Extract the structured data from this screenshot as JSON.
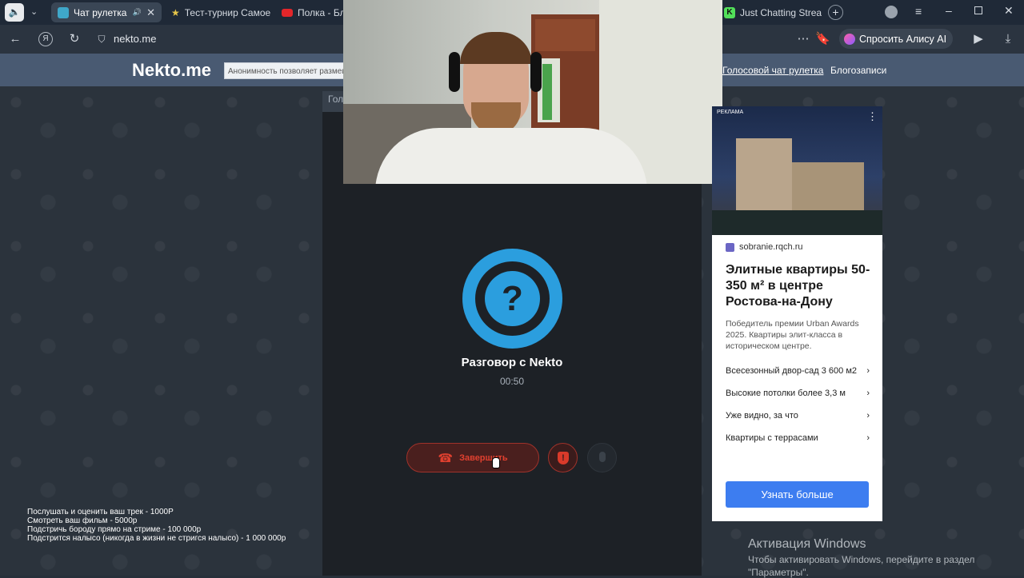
{
  "tabs": [
    {
      "title": "Чат рулетка го"
    },
    {
      "title": "Тест-турнир Самое"
    },
    {
      "title": "Полка - Бли"
    },
    {
      "title": "Just Chatting Strea"
    }
  ],
  "address": {
    "url": "nekto.me",
    "alice_button": "Спросить Алису AI"
  },
  "site": {
    "logo": "Nekto.me",
    "search_text": "Анонимность позволяет размеща",
    "nav": [
      "Голосовой чат рулетка",
      "Блогозаписи"
    ],
    "side_tab_partial": "Гол"
  },
  "call": {
    "title": "Разговор с Nekto",
    "timer": "00:50",
    "end_button": "Завершить"
  },
  "ad": {
    "label": "РЕКЛАМА",
    "domain": "sobranie.rqch.ru",
    "headline": "Элитные квартиры 50-350 м² в центре Ростова-на-Дону",
    "desc": "Победитель премии Urban Awards 2025. Квартиры элит-класса в историческом центре.",
    "items": [
      "Всесезонный двор-сад 3 600 м2",
      "Высокие потолки более 3,3 м",
      "Уже видно, за что",
      "Квартиры с террасами"
    ],
    "cta": "Узнать больше"
  },
  "notes": [
    "Послушать и оценить ваш трек - 1000Р",
    "Смотреть ваш фильм - 5000р",
    "Подстричь бороду прямо на стриме - 100 000р",
    "Подстрится налысо (никогда в жизни не стригся налысо) - 1 000 000р"
  ],
  "windows": {
    "title": "Активация Windows",
    "line1": "Чтобы активировать Windows, перейдите в раздел",
    "line2": "\"Параметры\"."
  },
  "colors": {
    "accent": "#2b9ede",
    "danger": "#d93a2a",
    "ad_cta": "#3d7df0"
  }
}
